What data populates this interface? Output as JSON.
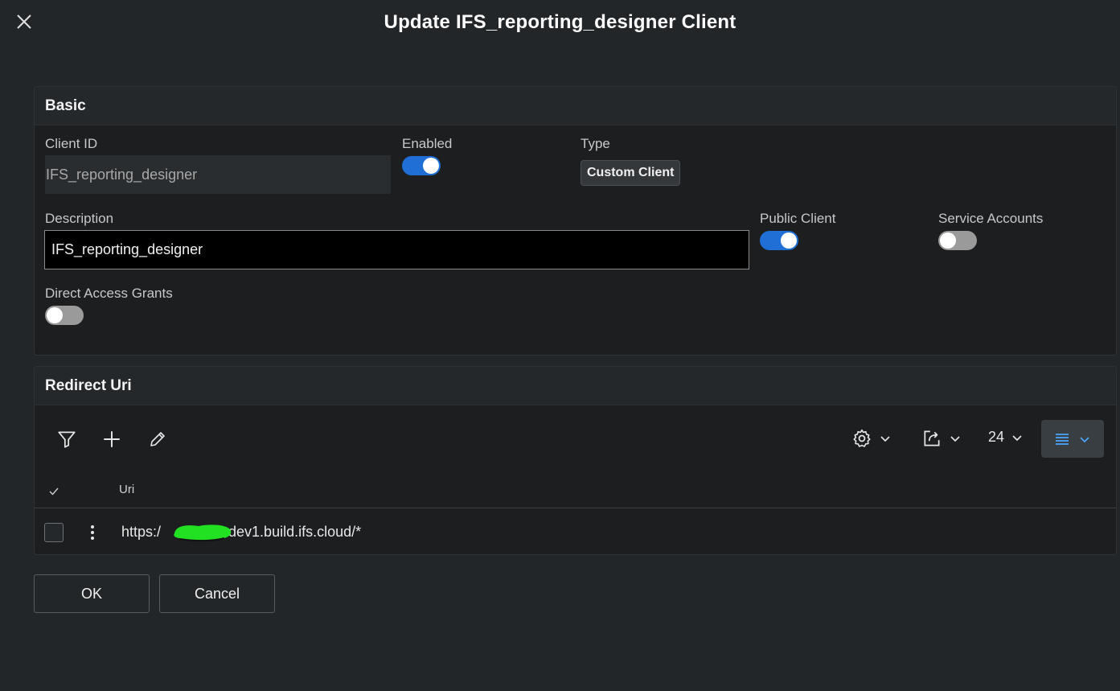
{
  "dialog": {
    "title": "Update IFS_reporting_designer Client",
    "close_icon": "close-icon"
  },
  "basic": {
    "heading": "Basic",
    "client_id_label": "Client ID",
    "client_id_value": "IFS_reporting_designer",
    "enabled_label": "Enabled",
    "enabled": true,
    "type_label": "Type",
    "type_value": "Custom Client",
    "description_label": "Description",
    "description_value": "IFS_reporting_designer",
    "public_client_label": "Public Client",
    "public_client": true,
    "service_accounts_label": "Service Accounts",
    "service_accounts": false,
    "direct_access_label": "Direct Access Grants",
    "direct_access": false
  },
  "redirect": {
    "heading": "Redirect Uri",
    "toolbar": {
      "icons": [
        "filter-icon",
        "plus-icon",
        "pencil-icon",
        "gear-icon",
        "export-icon",
        "list-view-icon"
      ],
      "page_size": "24"
    },
    "column_header": "Uri",
    "rows": [
      {
        "uri_prefix": "https:/",
        "uri_suffix": "-dev1.build.ifs.cloud/*"
      }
    ]
  },
  "footer": {
    "ok_label": "OK",
    "cancel_label": "Cancel"
  },
  "colors": {
    "accent": "#1f6fd6",
    "background": "#232628",
    "panel": "#1c1e20",
    "redaction": "#22e022"
  }
}
